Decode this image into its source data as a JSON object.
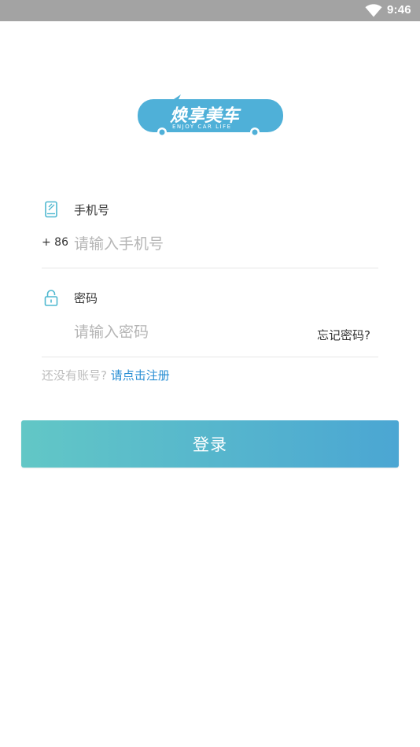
{
  "status_bar": {
    "time": "9:46",
    "wifi_icon": "wifi-icon"
  },
  "logo": {
    "text": "焕享美车",
    "subtext": "ENJOY CAR LIFE",
    "color": "#4fb0d8"
  },
  "phone_field": {
    "icon": "phone-icon",
    "label": "手机号",
    "country_code": "+ 86",
    "placeholder": "请输入手机号",
    "value": ""
  },
  "password_field": {
    "icon": "lock-icon",
    "label": "密码",
    "placeholder": "请输入密码",
    "value": ""
  },
  "forgot_password": "忘记密码?",
  "register": {
    "prompt": "还没有账号?",
    "link": "请点击注册"
  },
  "login_button": {
    "label": "登录",
    "gradient_start": "#62c7c6",
    "gradient_end": "#4ba6d3"
  },
  "colors": {
    "accent": "#4fb0d8",
    "link": "#2a8fd4",
    "placeholder": "#b5b5b5",
    "divider": "#e6e6e6",
    "status_bar": "#a3a3a3"
  }
}
